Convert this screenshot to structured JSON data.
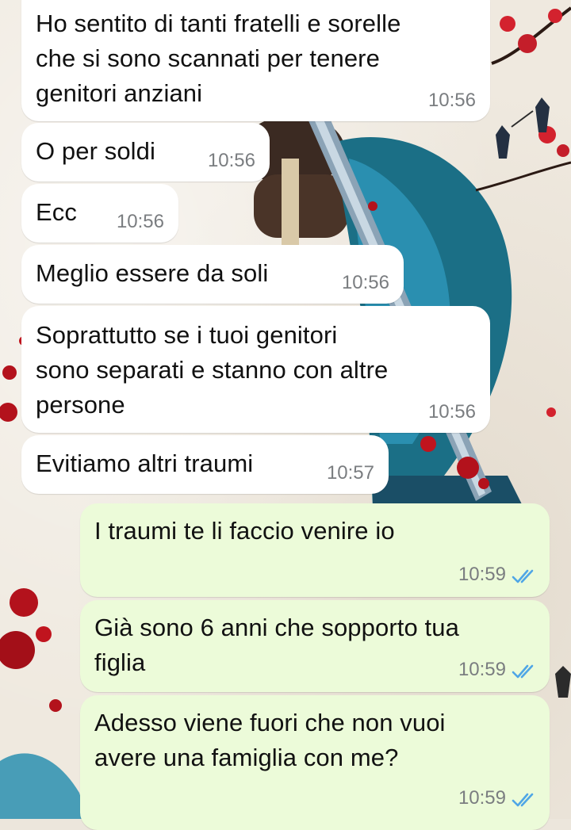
{
  "messages": [
    {
      "direction": "incoming",
      "text": "Ho sentito di tanti fratelli e sorelle\nche si sono scannati per tenere\ngenitori anziani",
      "time": "10:56"
    },
    {
      "direction": "incoming",
      "text": "O per soldi",
      "time": "10:56"
    },
    {
      "direction": "incoming",
      "text": "Ecc",
      "time": "10:56"
    },
    {
      "direction": "incoming",
      "text": "Meglio essere da soli",
      "time": "10:56"
    },
    {
      "direction": "incoming",
      "text": "Soprattutto se i tuoi genitori\nsono separati e stanno con altre\npersone",
      "time": "10:56"
    },
    {
      "direction": "incoming",
      "text": "Evitiamo altri traumi",
      "time": "10:57"
    },
    {
      "direction": "outgoing",
      "text": "I traumi te li faccio venire io",
      "time": "10:59",
      "status": "read"
    },
    {
      "direction": "outgoing",
      "text": "Già sono 6 anni che sopporto tua\nfiglia",
      "time": "10:59",
      "status": "read"
    },
    {
      "direction": "outgoing",
      "text": "Adesso viene fuori che non vuoi\navere una famiglia con me?",
      "time": "10:59",
      "status": "read"
    }
  ],
  "colors": {
    "incoming_bubble": "#ffffff",
    "outgoing_bubble": "#ecfbd9",
    "timestamp": "#7a7d80",
    "read_ticks": "#4fa6e6"
  },
  "icons": {
    "read_receipt": "double-check-icon",
    "wallpaper": "samurai-wallpaper"
  }
}
